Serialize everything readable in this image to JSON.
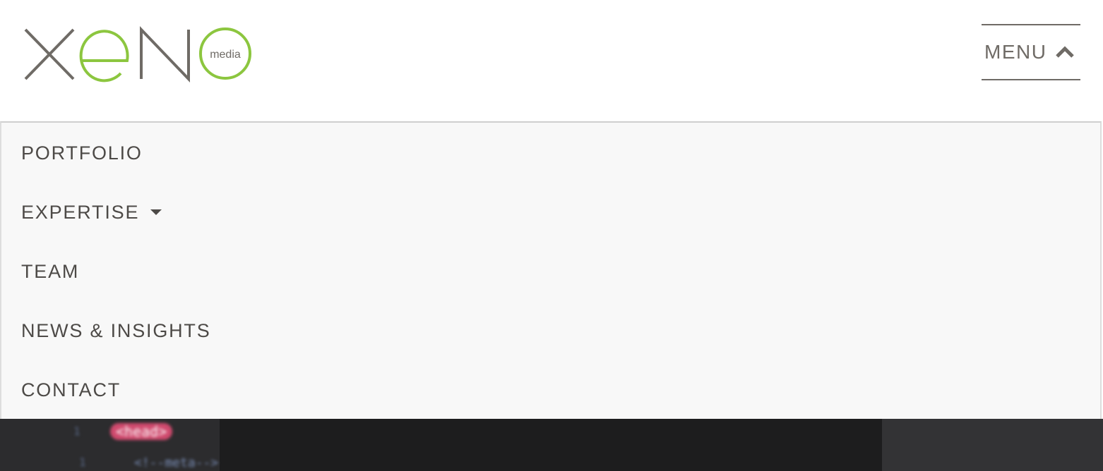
{
  "brand": {
    "logo_main": "XEN",
    "logo_sub": "media",
    "colors": {
      "gray": "#6f6b66",
      "green": "#8cc63f"
    }
  },
  "header": {
    "menu_label": "MENU",
    "menu_icon": "chevron-up-icon"
  },
  "nav": {
    "items": [
      {
        "label": "PORTFOLIO",
        "has_dropdown": false
      },
      {
        "label": "EXPERTISE",
        "has_dropdown": true
      },
      {
        "label": "TEAM",
        "has_dropdown": false
      },
      {
        "label": "NEWS & INSIGHTS",
        "has_dropdown": false
      },
      {
        "label": "CONTACT",
        "has_dropdown": false
      }
    ]
  },
  "hero": {
    "code_line_1": "<head>",
    "code_line_2": "<!--meta-->"
  }
}
